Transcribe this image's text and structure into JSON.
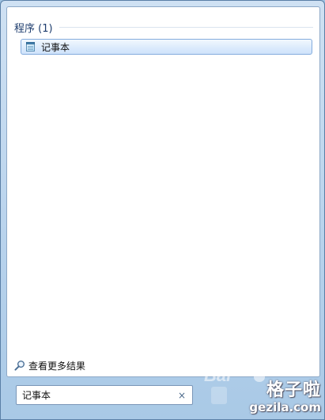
{
  "results": {
    "group_title": "程序 (1)",
    "items": [
      {
        "label": "记事本",
        "icon": "notepad-icon"
      }
    ]
  },
  "see_more": {
    "label": "查看更多结果",
    "icon": "magnifier-icon"
  },
  "search": {
    "value": "记事本",
    "clear_glyph": "×"
  },
  "watermark": {
    "logo_text": "Bai",
    "site_name": "格子啦",
    "site_url": "gezila.com"
  },
  "colors": {
    "accent": "#1e3d6e",
    "selection": "#cfe3fb",
    "frame": "#b7d2ec"
  }
}
